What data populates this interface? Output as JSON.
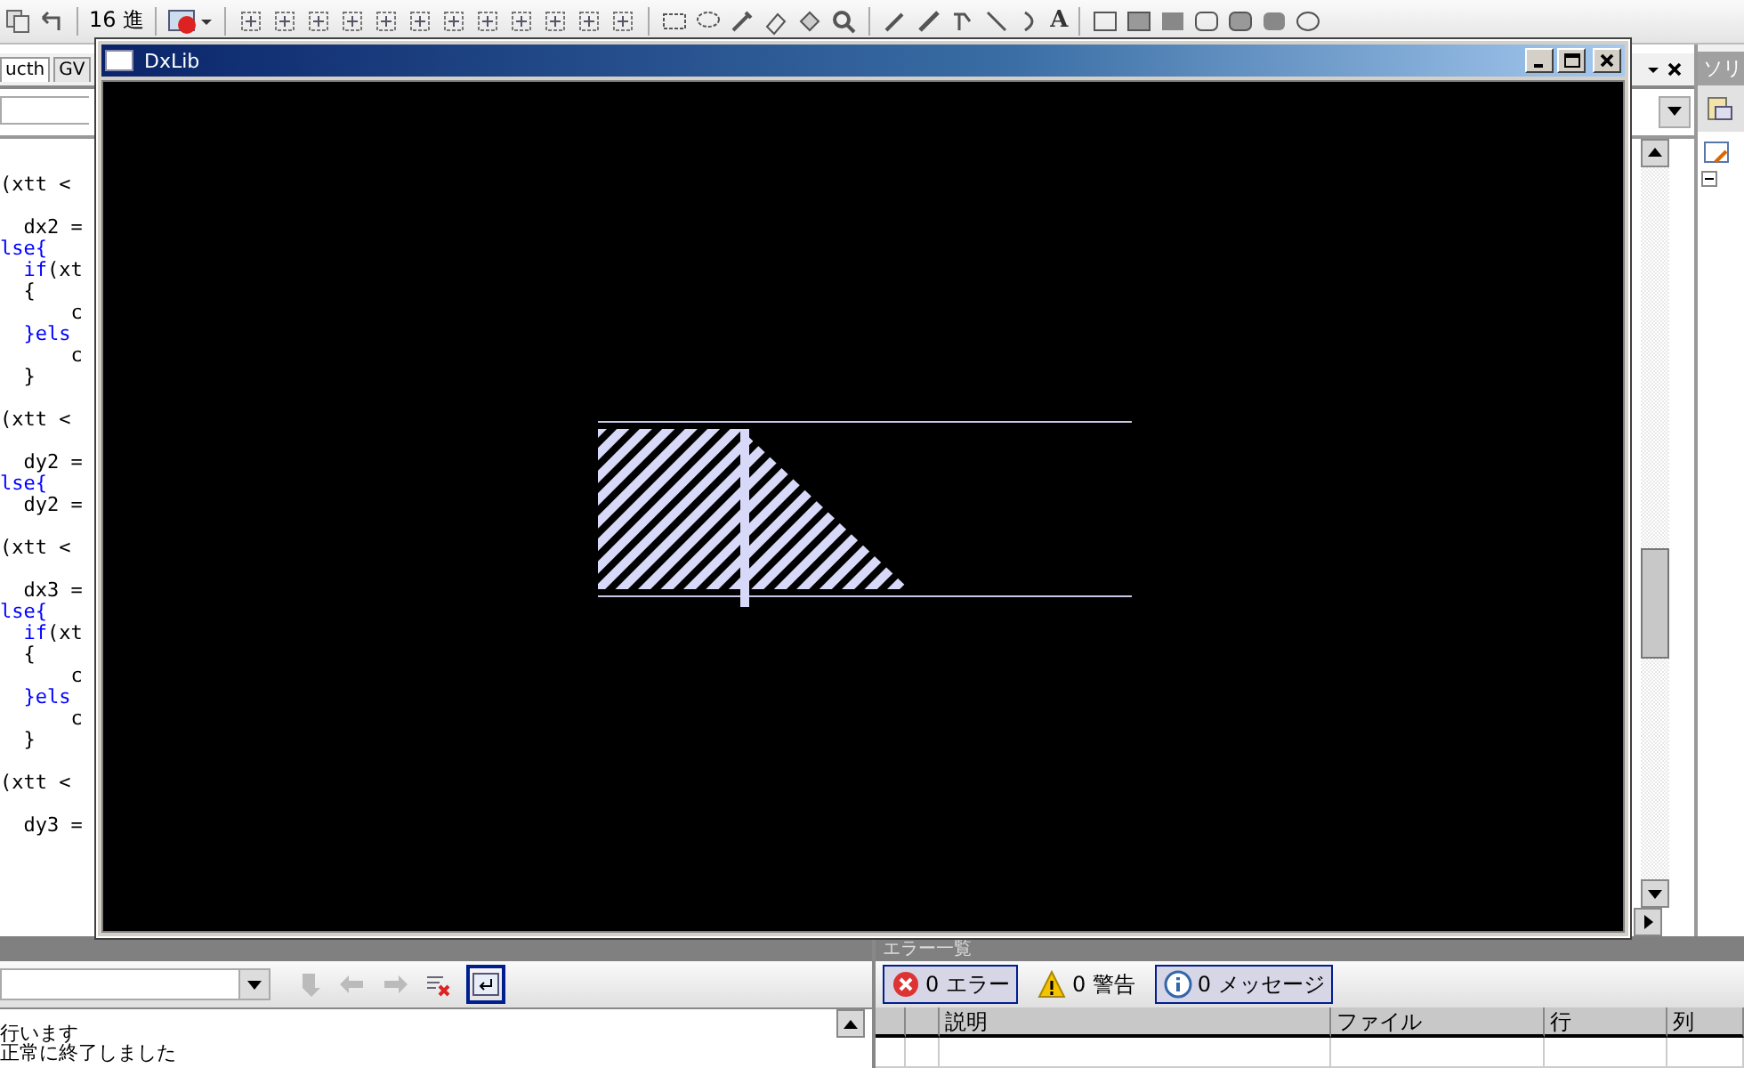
{
  "toolbar": {
    "hex_label": "16 進",
    "text_tool": "A"
  },
  "editor": {
    "tabs": [
      {
        "label": "ucth",
        "selected": true
      },
      {
        "label": "GV",
        "selected": false
      }
    ],
    "code_blocks": [
      [
        {
          "segments": [
            {
              "text": "(xtt <",
              "keyword": false
            }
          ]
        }
      ],
      [
        {
          "segments": [
            {
              "text": "  dx2 =",
              "keyword": false
            }
          ]
        },
        {
          "segments": [
            {
              "text": "lse{",
              "keyword": true
            }
          ]
        },
        {
          "segments": [
            {
              "text": "  if",
              "keyword": true
            },
            {
              "text": "(xt",
              "keyword": false
            }
          ]
        },
        {
          "segments": [
            {
              "text": "  {",
              "keyword": false
            }
          ]
        },
        {
          "segments": [
            {
              "text": "      c",
              "keyword": false
            }
          ]
        },
        {
          "segments": [
            {
              "text": "  }els",
              "keyword": true
            }
          ]
        },
        {
          "segments": [
            {
              "text": "      c",
              "keyword": false
            }
          ]
        },
        {
          "segments": [
            {
              "text": "  }",
              "keyword": false
            }
          ]
        }
      ],
      [
        {
          "segments": [
            {
              "text": "(xtt <",
              "keyword": false
            }
          ]
        }
      ],
      [
        {
          "segments": [
            {
              "text": "  dy2 =",
              "keyword": false
            }
          ]
        },
        {
          "segments": [
            {
              "text": "lse{",
              "keyword": true
            }
          ]
        },
        {
          "segments": [
            {
              "text": "  dy2 =",
              "keyword": false
            }
          ]
        }
      ],
      [
        {
          "segments": [
            {
              "text": "(xtt <",
              "keyword": false
            }
          ]
        }
      ],
      [
        {
          "segments": [
            {
              "text": "  dx3 =",
              "keyword": false
            }
          ]
        },
        {
          "segments": [
            {
              "text": "lse{",
              "keyword": true
            }
          ]
        },
        {
          "segments": [
            {
              "text": "  if",
              "keyword": true
            },
            {
              "text": "(xt",
              "keyword": false
            }
          ]
        },
        {
          "segments": [
            {
              "text": "  {",
              "keyword": false
            }
          ]
        },
        {
          "segments": [
            {
              "text": "      c",
              "keyword": false
            }
          ]
        },
        {
          "segments": [
            {
              "text": "  }els",
              "keyword": true
            }
          ]
        },
        {
          "segments": [
            {
              "text": "      c",
              "keyword": false
            }
          ]
        },
        {
          "segments": [
            {
              "text": "  }",
              "keyword": false
            }
          ]
        }
      ],
      [
        {
          "segments": [
            {
              "text": "(xtt <",
              "keyword": false
            }
          ]
        }
      ],
      [
        {
          "segments": [
            {
              "text": "  dy3 =",
              "keyword": false
            }
          ]
        }
      ]
    ]
  },
  "dxlib_window": {
    "title": "DxLib"
  },
  "output_panel": {
    "lines": [
      "行います",
      "正常に終了しました"
    ]
  },
  "error_list": {
    "title": "エラー一覧",
    "filters": [
      {
        "label": "0 エラー",
        "kind": "error",
        "selected": true
      },
      {
        "label": "0 警告",
        "kind": "warning",
        "selected": false
      },
      {
        "label": "0 メッセージ",
        "kind": "info",
        "selected": true
      }
    ],
    "columns": [
      "説明",
      "ファイル",
      "行",
      "列"
    ]
  },
  "solution_panel": {
    "title": "ソリ"
  }
}
